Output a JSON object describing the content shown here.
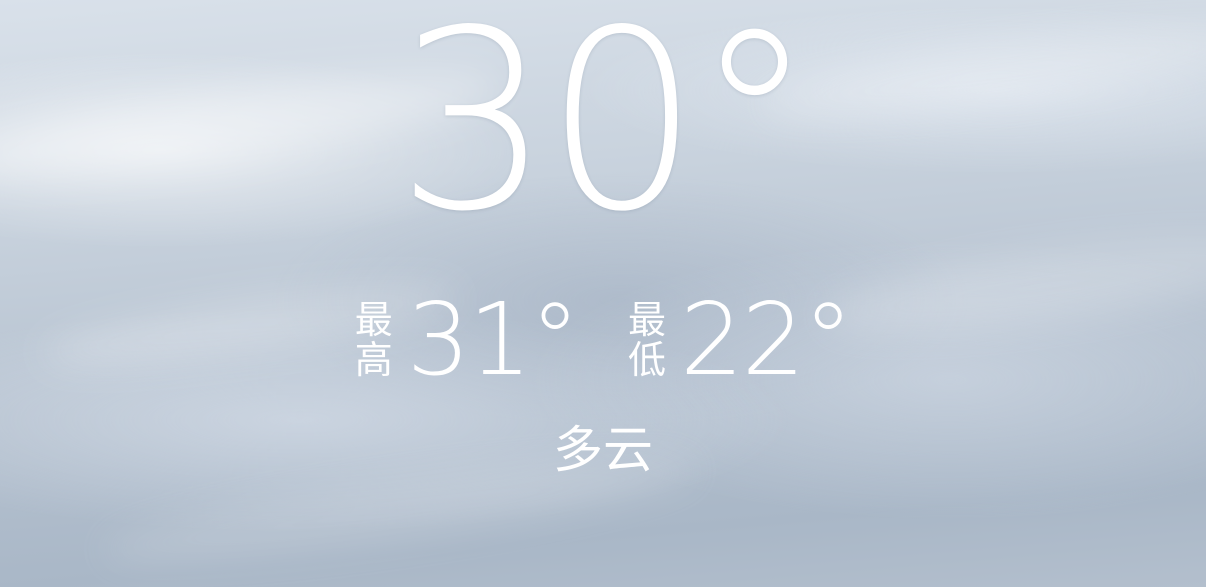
{
  "current": {
    "temperature": "30°"
  },
  "high": {
    "label_line1": "最",
    "label_line2": "高",
    "value": "31°"
  },
  "low": {
    "label_line1": "最",
    "label_line2": "低",
    "value": "22°"
  },
  "condition": "多云",
  "background": {
    "theme": "cloudy-sky",
    "colors": [
      "#d9e1ea",
      "#b6c2d0",
      "#a9b7c7"
    ]
  }
}
